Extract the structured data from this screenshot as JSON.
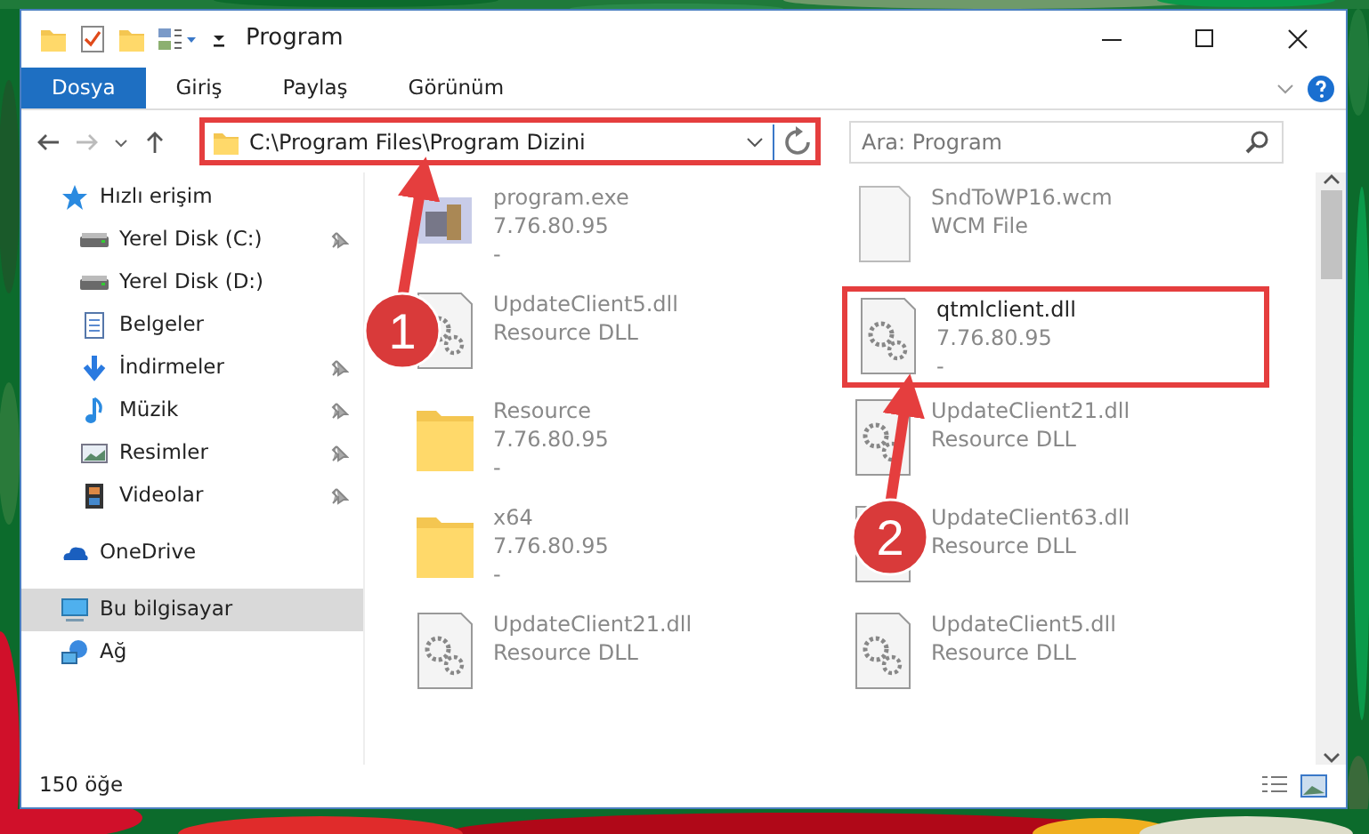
{
  "window": {
    "title": "Program"
  },
  "ribbon_tabs": [
    {
      "label": "Dosya",
      "selected": true
    },
    {
      "label": "Giriş",
      "selected": false
    },
    {
      "label": "Paylaş",
      "selected": false
    },
    {
      "label": "Görünüm",
      "selected": false
    }
  ],
  "address_bar": {
    "path": "C:\\Program Files\\Program Dizini",
    "highlighted": true
  },
  "search": {
    "placeholder": "Ara: Program"
  },
  "sidebar": {
    "items": [
      {
        "label": "Hızlı erişim",
        "kind": "star",
        "selected": false,
        "children": [
          {
            "label": "Yerel Disk (C:)",
            "kind": "drive",
            "pinned": true,
            "selected": false
          },
          {
            "label": "Yerel Disk (D:)",
            "kind": "drive",
            "pinned": false,
            "selected": false
          },
          {
            "label": "Belgeler",
            "kind": "documents",
            "pinned": false,
            "selected": false
          },
          {
            "label": "İndirmeler",
            "kind": "download",
            "pinned": true,
            "selected": false
          },
          {
            "label": "Müzik",
            "kind": "music",
            "pinned": true,
            "selected": false
          },
          {
            "label": "Resimler",
            "kind": "pictures",
            "pinned": true,
            "selected": false
          },
          {
            "label": "Videolar",
            "kind": "videos",
            "pinned": true,
            "selected": false
          }
        ]
      },
      {
        "label": "OneDrive",
        "kind": "cloud",
        "selected": false
      },
      {
        "label": "Bu bilgisayar",
        "kind": "computer",
        "selected": true
      },
      {
        "label": "Ağ",
        "kind": "network",
        "selected": false
      }
    ]
  },
  "files": [
    {
      "name": "program.exe",
      "details": [
        "7.76.80.95",
        "-"
      ],
      "kind": "exe",
      "highlighted": false
    },
    {
      "name": "UpdateClient5.dll",
      "details": [
        "Resource DLL"
      ],
      "kind": "dll",
      "highlighted": false
    },
    {
      "name": "Resource",
      "details": [
        "7.76.80.95",
        "-"
      ],
      "kind": "folder",
      "highlighted": false
    },
    {
      "name": "x64",
      "details": [
        "7.76.80.95",
        "-"
      ],
      "kind": "folder",
      "highlighted": false
    },
    {
      "name": "UpdateClient21.dll",
      "details": [
        "Resource DLL"
      ],
      "kind": "dll",
      "highlighted": false
    },
    {
      "name": "SndToWP16.wcm",
      "details": [
        "WCM File"
      ],
      "kind": "file",
      "highlighted": false
    },
    {
      "name": "qtmlclient.dll",
      "details": [
        "7.76.80.95",
        "-"
      ],
      "kind": "dll",
      "highlighted": true
    },
    {
      "name": "UpdateClient21.dll",
      "details": [
        "Resource DLL"
      ],
      "kind": "dll",
      "highlighted": false
    },
    {
      "name": "UpdateClient63.dll",
      "details": [
        "Resource DLL"
      ],
      "kind": "dll",
      "highlighted": false
    },
    {
      "name": "UpdateClient5.dll",
      "details": [
        "Resource DLL"
      ],
      "kind": "dll",
      "highlighted": false
    }
  ],
  "status_bar": {
    "item_count": "150 öğe"
  },
  "annotations": [
    {
      "number": "1"
    },
    {
      "number": "2"
    }
  ]
}
